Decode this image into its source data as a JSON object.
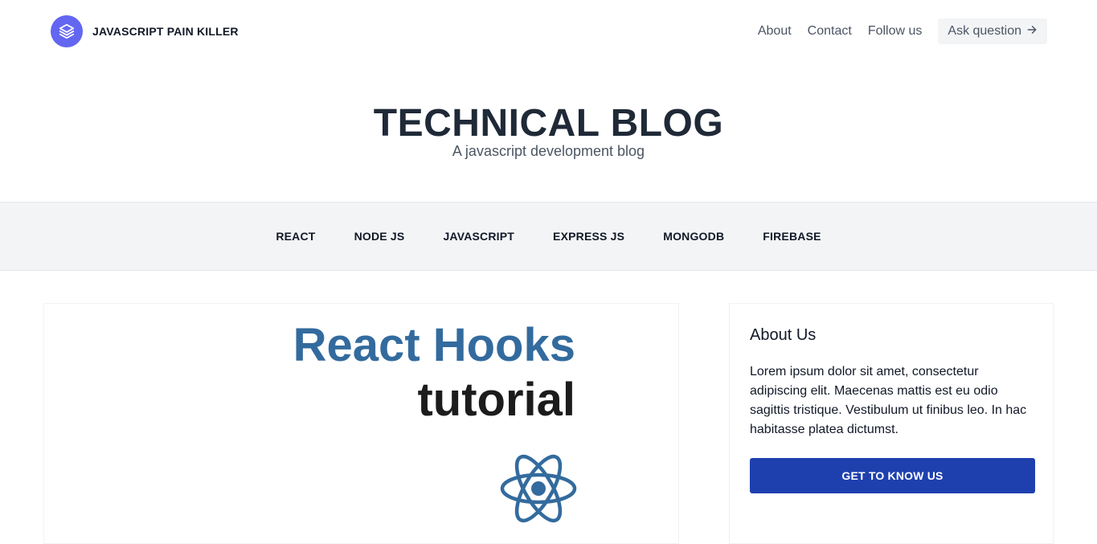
{
  "header": {
    "brand_name": "JAVASCRIPT PAIN KILLER",
    "brand_icon": "layers-icon",
    "nav": [
      {
        "label": "About"
      },
      {
        "label": "Contact"
      },
      {
        "label": "Follow us"
      }
    ],
    "ask_label": "Ask question",
    "ask_icon": "arrow-right-icon"
  },
  "hero": {
    "title": "TECHNICAL BLOG",
    "subtitle": "A javascript development blog"
  },
  "categories": [
    {
      "label": "REACT"
    },
    {
      "label": "NODE JS"
    },
    {
      "label": "JAVASCRIPT"
    },
    {
      "label": "EXPRESS JS"
    },
    {
      "label": "MONGODB"
    },
    {
      "label": "FIREBASE"
    }
  ],
  "post": {
    "title_line1": "React Hooks",
    "title_line2": "tutorial",
    "icon": "react-logo-icon",
    "accent_color": "#336b9e"
  },
  "sidebar": {
    "about_title": "About Us",
    "about_text": "Lorem ipsum dolor sit amet, consectetur adipiscing elit. Maecenas mattis est eu odio sagittis tristique. Vestibulum ut finibus leo. In hac habitasse platea dictumst.",
    "button_label": "GET TO KNOW US",
    "button_color": "#1e40af"
  },
  "colors": {
    "brand": "#6366f1",
    "nav_bg": "#f3f4f6"
  }
}
